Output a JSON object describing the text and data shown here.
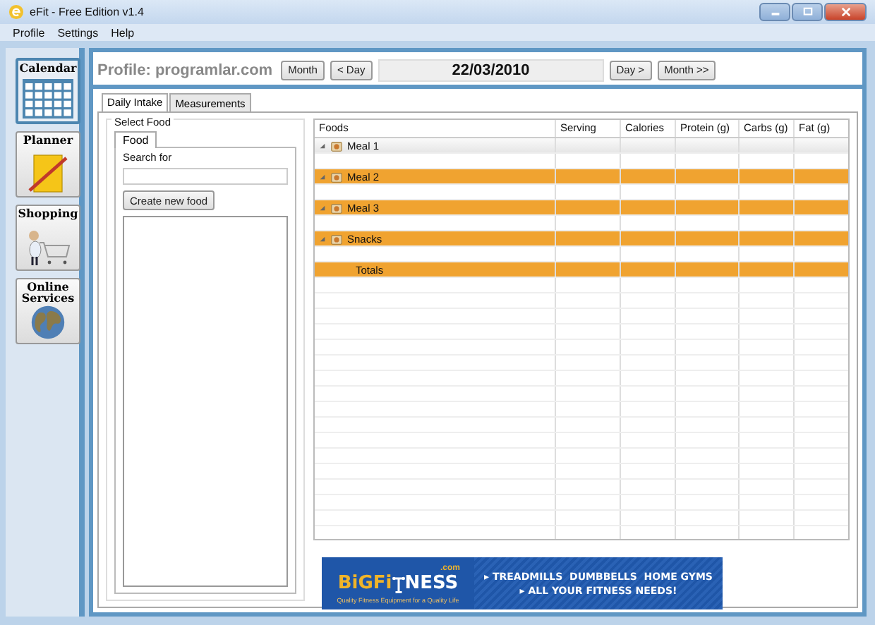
{
  "window": {
    "title": "eFit - Free Edition v1.4"
  },
  "menu": [
    "Profile",
    "Settings",
    "Help"
  ],
  "sidebar": [
    {
      "label": "Calendar",
      "kind": "calendar",
      "selected": true
    },
    {
      "label": "Planner",
      "kind": "planner",
      "selected": false
    },
    {
      "label": "Shopping",
      "kind": "shopping",
      "selected": false
    },
    {
      "label": "Online Services",
      "kind": "globe",
      "selected": false
    }
  ],
  "header": {
    "profile": "Profile: programlar.com",
    "prev_month": "Month",
    "prev_day": "< Day",
    "date": "22/03/2010",
    "next_day": "Day >",
    "next_month": "Month >>"
  },
  "tabs": [
    {
      "label": "Daily Intake",
      "selected": true
    },
    {
      "label": "Measurements",
      "selected": false
    }
  ],
  "select_food": {
    "title": "Select Food",
    "tab": "Food",
    "search_label": "Search for",
    "create_button": "Create new food"
  },
  "table": {
    "columns": [
      "Foods",
      "Serving",
      "Calories",
      "Protein (g)",
      "Carbs (g)",
      "Fat (g)"
    ],
    "rows": [
      {
        "kind": "group",
        "label": "Meal 1",
        "selected": true
      },
      {
        "kind": "empty"
      },
      {
        "kind": "group",
        "label": "Meal 2",
        "selected": false
      },
      {
        "kind": "empty"
      },
      {
        "kind": "group",
        "label": "Meal 3",
        "selected": false
      },
      {
        "kind": "empty"
      },
      {
        "kind": "group",
        "label": "Snacks",
        "selected": false
      },
      {
        "kind": "empty"
      },
      {
        "kind": "total",
        "label": "Totals"
      }
    ]
  },
  "ad": {
    "brand_left": "BiGFi",
    "brand_right": "NESS",
    "domain": ".com",
    "tagline": "Quality Fitness Equipment for a Quality Life",
    "line1": "▸ TREADMILLS  DUMBBELLS  HOME GYMS",
    "line2": "▸ ALL YOUR FITNESS NEEDS!"
  }
}
